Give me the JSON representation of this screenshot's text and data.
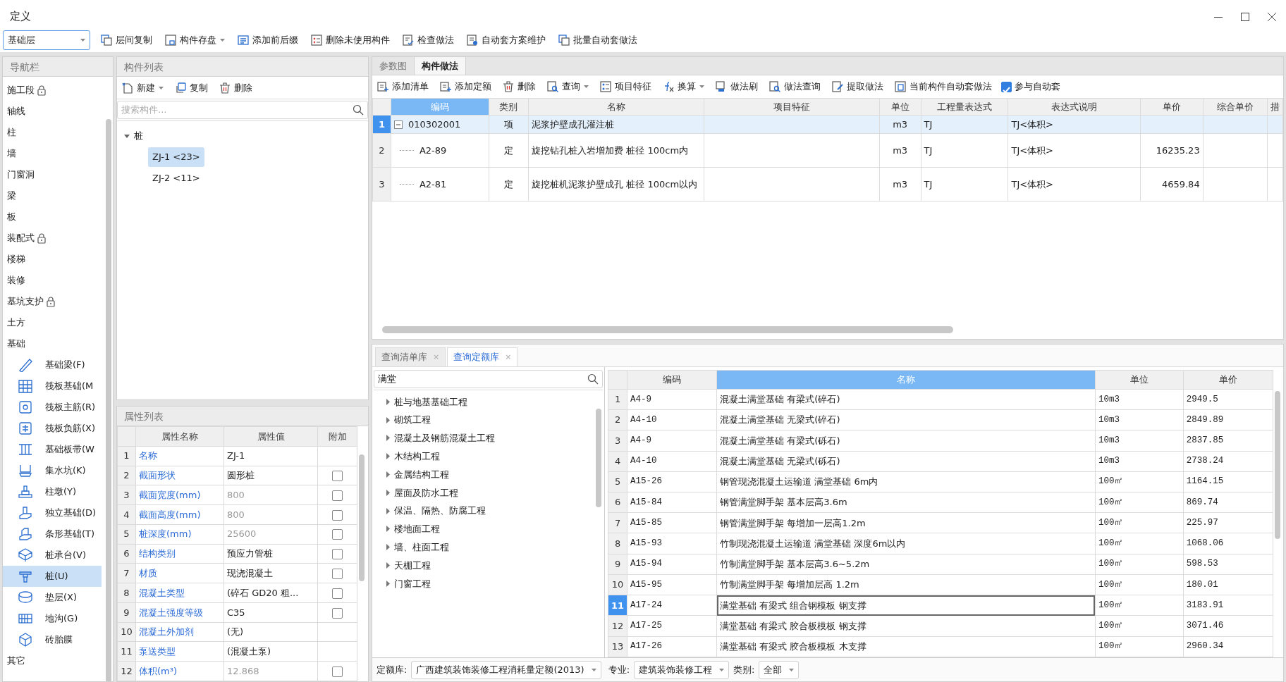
{
  "window": {
    "title": "定义"
  },
  "toolbar": {
    "floor": "基础层",
    "buttons": [
      {
        "label": "层间复制",
        "dropdown": false
      },
      {
        "label": "构件存盘",
        "dropdown": true
      },
      {
        "label": "添加前后缀",
        "dropdown": false
      },
      {
        "label": "删除未使用构件",
        "dropdown": false
      },
      {
        "label": "检查做法",
        "dropdown": false
      },
      {
        "label": "自动套方案维护",
        "dropdown": false
      },
      {
        "label": "批量自动套做法",
        "dropdown": false
      }
    ]
  },
  "navigator": {
    "title": "导航栏",
    "items": [
      {
        "label": "施工段",
        "locked": true
      },
      {
        "label": "轴线",
        "locked": false
      },
      {
        "label": "柱",
        "locked": false
      },
      {
        "label": "墙",
        "locked": false
      },
      {
        "label": "门窗洞",
        "locked": false
      },
      {
        "label": "梁",
        "locked": false
      },
      {
        "label": "板",
        "locked": false
      },
      {
        "label": "装配式",
        "locked": true
      },
      {
        "label": "楼梯",
        "locked": false
      },
      {
        "label": "装修",
        "locked": false
      },
      {
        "label": "基坑支护",
        "locked": true
      },
      {
        "label": "土方",
        "locked": false
      },
      {
        "label": "基础",
        "locked": false,
        "children": [
          {
            "label": "基础梁(F)",
            "selected": false
          },
          {
            "label": "筏板基础(M",
            "selected": false
          },
          {
            "label": "筏板主筋(R)",
            "selected": false
          },
          {
            "label": "筏板负筋(X)",
            "selected": false
          },
          {
            "label": "基础板带(W",
            "selected": false
          },
          {
            "label": "集水坑(K)",
            "selected": false
          },
          {
            "label": "柱墩(Y)",
            "selected": false
          },
          {
            "label": "独立基础(D)",
            "selected": false
          },
          {
            "label": "条形基础(T)",
            "selected": false
          },
          {
            "label": "桩承台(V)",
            "selected": false
          },
          {
            "label": "桩(U)",
            "selected": true
          },
          {
            "label": "垫层(X)",
            "selected": false
          },
          {
            "label": "地沟(G)",
            "selected": false
          },
          {
            "label": "砖胎膜",
            "selected": false
          }
        ]
      },
      {
        "label": "其它",
        "locked": false
      }
    ]
  },
  "component_list": {
    "title": "构件列表",
    "buttons": [
      {
        "label": "新建",
        "dropdown": true
      },
      {
        "label": "复制",
        "dropdown": false
      },
      {
        "label": "删除",
        "dropdown": false
      }
    ],
    "search": {
      "placeholder": "搜索构件..."
    },
    "tree": [
      {
        "label": "桩",
        "expanded": true,
        "children": [
          {
            "label": "ZJ-1 <23>",
            "selected": true
          },
          {
            "label": "ZJ-2 <11>",
            "selected": false
          }
        ]
      }
    ]
  },
  "properties": {
    "title": "属性列表",
    "columns": [
      "属性名称",
      "属性值",
      "附加"
    ],
    "rows": [
      {
        "index": "1",
        "name": "名称",
        "value": "ZJ-1",
        "greyed": false
      },
      {
        "index": "2",
        "name": "截面形状",
        "value": "圆形桩",
        "greyed": false,
        "checked": false
      },
      {
        "index": "3",
        "name": "截面宽度(mm)",
        "value": "800",
        "greyed": true,
        "checked": false
      },
      {
        "index": "4",
        "name": "截面高度(mm)",
        "value": "800",
        "greyed": true,
        "checked": false
      },
      {
        "index": "5",
        "name": "桩深度(mm)",
        "value": "25600",
        "greyed": true,
        "checked": false
      },
      {
        "index": "6",
        "name": "结构类别",
        "value": "预应力管桩",
        "greyed": false,
        "checked": false
      },
      {
        "index": "7",
        "name": "材质",
        "value": "现浇混凝土",
        "greyed": false,
        "checked": false
      },
      {
        "index": "8",
        "name": "混凝土类型",
        "value": "(碎石 GD20 粗...",
        "greyed": false,
        "checked": false
      },
      {
        "index": "9",
        "name": "混凝土强度等级",
        "value": "C35",
        "greyed": false,
        "checked": false
      },
      {
        "index": "10",
        "name": "混凝土外加剂",
        "value": "(无)",
        "greyed": false
      },
      {
        "index": "11",
        "name": "泵送类型",
        "value": "(混凝土泵)",
        "greyed": false
      },
      {
        "index": "12",
        "name": "体积(m³)",
        "value": "12.868",
        "greyed": true,
        "checked": false
      }
    ]
  },
  "method_panel": {
    "tabs": [
      {
        "label": "参数图",
        "selected": false
      },
      {
        "label": "构件做法",
        "selected": true
      }
    ],
    "buttons": [
      {
        "label": "添加清单",
        "dropdown": false
      },
      {
        "label": "添加定额",
        "dropdown": false
      },
      {
        "label": "删除",
        "dropdown": false
      },
      {
        "label": "查询",
        "dropdown": true
      },
      {
        "label": "项目特征",
        "dropdown": false
      },
      {
        "label": "换算",
        "dropdown": true
      },
      {
        "label": "做法刷",
        "dropdown": false
      },
      {
        "label": "做法查询",
        "dropdown": false
      },
      {
        "label": "提取做法",
        "dropdown": false
      },
      {
        "label": "当前构件自动套做法",
        "dropdown": false
      }
    ],
    "auto_checkbox": {
      "label": "参与自动套",
      "checked": true
    },
    "table": {
      "columns": [
        {
          "label": "编码",
          "selected": true
        },
        {
          "label": "类别",
          "selected": false
        },
        {
          "label": "名称",
          "selected": false
        },
        {
          "label": "项目特征",
          "selected": false
        },
        {
          "label": "单位",
          "selected": false
        },
        {
          "label": "工程量表达式",
          "selected": false
        },
        {
          "label": "表达式说明",
          "selected": false
        },
        {
          "label": "单价",
          "selected": false
        },
        {
          "label": "综合单价",
          "selected": false
        },
        {
          "label": "措",
          "selected": false
        }
      ],
      "rows": [
        {
          "index": "1",
          "code": "010302001",
          "category": "项",
          "name": "泥浆护壁成孔灌注桩",
          "unit": "m3",
          "expression": "TJ",
          "description": "TJ<体积>",
          "selected": true,
          "expanded": true,
          "children": [
            {
              "index": "2",
              "code": "A2-89",
              "category": "定",
              "name": "旋挖钻孔桩入岩增加费 桩径 100cm内",
              "unit": "m3",
              "expression": "TJ",
              "description": "TJ<体积>",
              "price": "16235.23",
              "selected": false
            },
            {
              "index": "3",
              "code": "A2-81",
              "category": "定",
              "name": "旋挖桩机泥浆护壁成孔 桩径 100cm以内",
              "unit": "m3",
              "expression": "TJ",
              "description": "TJ<体积>",
              "price": "4659.84",
              "selected": false
            }
          ]
        }
      ]
    }
  },
  "query_panel": {
    "tabs": [
      {
        "label": "查询清单库",
        "close": "×",
        "selected": false
      },
      {
        "label": "查询定额库",
        "close": "×",
        "selected": true
      }
    ],
    "search": {
      "value": "满堂"
    },
    "categories": [
      {
        "label": "桩与地基基础工程",
        "expanded": false
      },
      {
        "label": "砌筑工程",
        "expanded": false
      },
      {
        "label": "混凝土及钢筋混凝土工程",
        "expanded": false
      },
      {
        "label": "木结构工程",
        "expanded": false
      },
      {
        "label": "金属结构工程",
        "expanded": false
      },
      {
        "label": "屋面及防水工程",
        "expanded": false
      },
      {
        "label": "保温、隔热、防腐工程",
        "expanded": false
      },
      {
        "label": "楼地面工程",
        "expanded": false
      },
      {
        "label": "墙、柱面工程",
        "expanded": false
      },
      {
        "label": "天棚工程",
        "expanded": false
      },
      {
        "label": "门窗工程",
        "expanded": false
      }
    ],
    "table": {
      "columns": [
        {
          "label": "编码",
          "selected": false
        },
        {
          "label": "名称",
          "selected": true
        },
        {
          "label": "单位",
          "selected": false
        },
        {
          "label": "单价",
          "selected": false
        }
      ],
      "rows": [
        {
          "index": "1",
          "code": "A4-9",
          "name": "混凝土满堂基础 有梁式(碎石)",
          "unit": "10m3",
          "price": "2949.5",
          "selected": false
        },
        {
          "index": "2",
          "code": "A4-10",
          "name": "混凝土满堂基础 无梁式(碎石)",
          "unit": "10m3",
          "price": "2849.89",
          "selected": false
        },
        {
          "index": "3",
          "code": "A4-9",
          "name": "混凝土满堂基础 有梁式(砾石)",
          "unit": "10m3",
          "price": "2837.85",
          "selected": false
        },
        {
          "index": "4",
          "code": "A4-10",
          "name": "混凝土满堂基础 无梁式(砾石)",
          "unit": "10m3",
          "price": "2738.24",
          "selected": false
        },
        {
          "index": "5",
          "code": "A15-26",
          "name": "钢管现浇混凝土运输道 满堂基础 6m内",
          "unit": "100㎡",
          "price": "1164.15",
          "selected": false
        },
        {
          "index": "6",
          "code": "A15-84",
          "name": "钢管满堂脚手架 基本层高3.6m",
          "unit": "100㎡",
          "price": "869.74",
          "selected": false
        },
        {
          "index": "7",
          "code": "A15-85",
          "name": "钢管满堂脚手架 每增加一层高1.2m",
          "unit": "100㎡",
          "price": "225.97",
          "selected": false
        },
        {
          "index": "8",
          "code": "A15-93",
          "name": "竹制现浇混凝土运输道 满堂基础 深度6m以内",
          "unit": "100㎡",
          "price": "1068.06",
          "selected": false
        },
        {
          "index": "9",
          "code": "A15-94",
          "name": "竹制满堂脚手架 基本层高3.6~5.2m",
          "unit": "100㎡",
          "price": "598.53",
          "selected": false
        },
        {
          "index": "10",
          "code": "A15-95",
          "name": "竹制满堂脚手架 每增加层高 1.2m",
          "unit": "100㎡",
          "price": "180.01",
          "selected": false
        },
        {
          "index": "11",
          "code": "A17-24",
          "name": "满堂基础 有梁式 组合钢模板 钢支撑",
          "unit": "100㎡",
          "price": "3183.91",
          "selected": true
        },
        {
          "index": "12",
          "code": "A17-25",
          "name": "满堂基础 有梁式 胶合板模板 钢支撑",
          "unit": "100㎡",
          "price": "3071.46",
          "selected": false
        },
        {
          "index": "13",
          "code": "A17-26",
          "name": "满堂基础 有梁式 胶合板模板 木支撑",
          "unit": "100㎡",
          "price": "2960.34",
          "selected": false
        }
      ]
    },
    "footer": [
      {
        "label": "定额库:",
        "value": "广西建筑装饰装修工程消耗量定额(2013)"
      },
      {
        "label": "专业:",
        "value": "建筑装饰装修工程"
      },
      {
        "label": "类别:",
        "value": "全部"
      }
    ]
  }
}
